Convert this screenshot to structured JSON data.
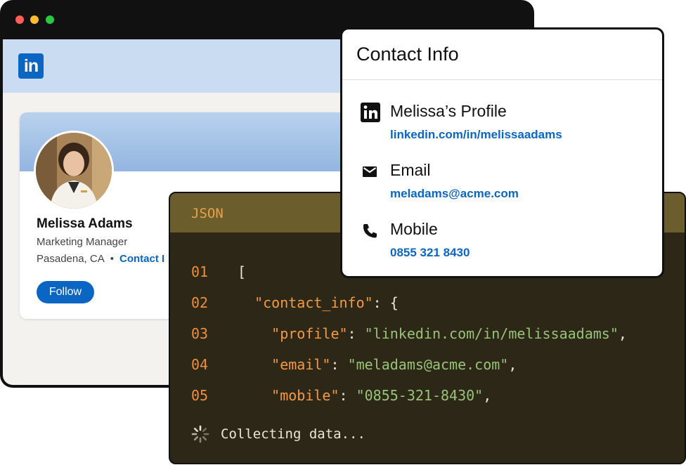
{
  "linkedin_logo": "in",
  "profile": {
    "name": "Melissa Adams",
    "title": "Marketing Manager",
    "location": "Pasadena, CA",
    "separator": "•",
    "contact_link": "Contact I",
    "follow_label": "Follow"
  },
  "contact_info": {
    "title": "Contact Info",
    "items": [
      {
        "label": "Melissa’s Profile",
        "value": "linkedin.com/in/melissaadams",
        "icon": "linkedin-icon"
      },
      {
        "label": "Email",
        "value": "meladams@acme.com",
        "icon": "mail-icon"
      },
      {
        "label": "Mobile",
        "value": "0855 321 8430",
        "icon": "phone-icon"
      }
    ]
  },
  "json_panel": {
    "label": "JSON",
    "lines": [
      {
        "num": "01",
        "indent": "",
        "key": "",
        "value": "",
        "text": "["
      },
      {
        "num": "02",
        "indent": "  ",
        "key": "\"contact_info\"",
        "value": "",
        "text": ": {"
      },
      {
        "num": "03",
        "indent": "    ",
        "key": "\"profile\"",
        "value": "\"linkedin.com/in/melissaadams\"",
        "text": ","
      },
      {
        "num": "04",
        "indent": "    ",
        "key": "\"email\"",
        "value": "\"meladams@acme.com\"",
        "text": ","
      },
      {
        "num": "05",
        "indent": "    ",
        "key": "\"mobile\"",
        "value": "\"0855-321-8430\"",
        "text": ","
      }
    ],
    "status": "Collecting data..."
  },
  "colors": {
    "linkedin_blue": "#0a66c2",
    "json_key": "#f29a45",
    "json_string": "#98c379"
  }
}
